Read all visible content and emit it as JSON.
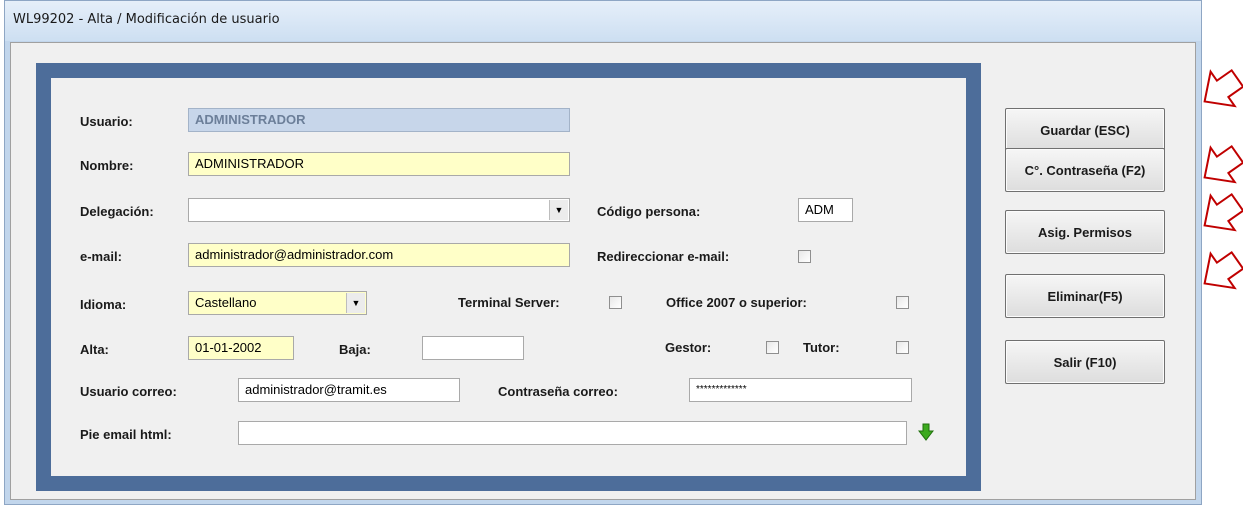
{
  "window": {
    "title": "WL99202 - Alta / Modificación de usuario"
  },
  "form": {
    "usuario": {
      "label": "Usuario:",
      "value": "ADMINISTRADOR"
    },
    "nombre": {
      "label": "Nombre:",
      "value": "ADMINISTRADOR"
    },
    "delegacion": {
      "label": "Delegación:",
      "value": ""
    },
    "codigo_persona": {
      "label": "Código persona:",
      "value": "ADM"
    },
    "email": {
      "label": "e-mail:",
      "value": "administrador@administrador.com"
    },
    "redireccionar": {
      "label": "Redireccionar e-mail:",
      "checked": false
    },
    "idioma": {
      "label": "Idioma:",
      "value": "Castellano"
    },
    "terminal_server": {
      "label": "Terminal Server:",
      "checked": false
    },
    "office": {
      "label": "Office 2007 o superior:",
      "checked": false
    },
    "alta": {
      "label": "Alta:",
      "value": "01-01-2002"
    },
    "baja": {
      "label": "Baja:",
      "value": ""
    },
    "gestor": {
      "label": "Gestor:",
      "checked": false
    },
    "tutor": {
      "label": "Tutor:",
      "checked": false
    },
    "usuario_correo": {
      "label": "Usuario correo:",
      "value": "administrador@tramit.es"
    },
    "contrasena_correo": {
      "label": "Contraseña correo:",
      "value": "*************"
    },
    "pie_email": {
      "label": "Pie email html:",
      "value": ""
    }
  },
  "buttons": {
    "guardar": "Guardar (ESC)",
    "contrasena": "C°. Contraseña (F2)",
    "permisos": "Asig. Permisos",
    "eliminar": "Eliminar(F5)",
    "salir": "Salir (F10)"
  },
  "colors": {
    "frame_blue": "#4d6d9a",
    "required_yellow": "#ffffc8",
    "annotation_arrow": "#c00000",
    "expand_arrow": "#3caa1e"
  },
  "icons": {
    "expand": "green-down-arrow-icon",
    "annotation": "red-outline-arrow-icon"
  }
}
